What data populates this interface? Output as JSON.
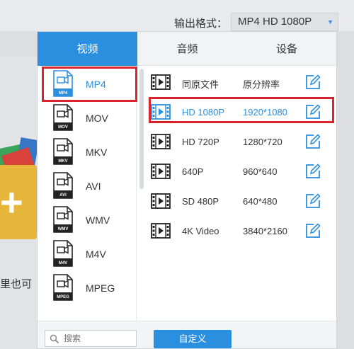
{
  "background": {
    "partial_text": "里也可"
  },
  "output_format": {
    "label": "输出格式：",
    "value": "MP4  HD 1080P"
  },
  "tabs": [
    {
      "label": "视频",
      "active": true
    },
    {
      "label": "音频",
      "active": false
    },
    {
      "label": "设备",
      "active": false
    }
  ],
  "formats": [
    {
      "name": "MP4",
      "badge": "MP4",
      "selected": true
    },
    {
      "name": "MOV",
      "badge": "MOV",
      "selected": false
    },
    {
      "name": "MKV",
      "badge": "MKV",
      "selected": false
    },
    {
      "name": "AVI",
      "badge": "AVI",
      "selected": false
    },
    {
      "name": "WMV",
      "badge": "WMV",
      "selected": false
    },
    {
      "name": "M4V",
      "badge": "M4V",
      "selected": false
    },
    {
      "name": "MPEG",
      "badge": "MPEG",
      "selected": false
    }
  ],
  "resolutions": [
    {
      "name": "同原文件",
      "res": "原分辨率",
      "selected": false
    },
    {
      "name": "HD 1080P",
      "res": "1920*1080",
      "selected": true
    },
    {
      "name": "HD 720P",
      "res": "1280*720",
      "selected": false
    },
    {
      "name": "640P",
      "res": "960*640",
      "selected": false
    },
    {
      "name": "SD 480P",
      "res": "640*480",
      "selected": false
    },
    {
      "name": "4K Video",
      "res": "3840*2160",
      "selected": false
    }
  ],
  "search": {
    "placeholder": "搜索",
    "value": ""
  },
  "custom_button": "自定义",
  "colors": {
    "accent": "#2b8fdf",
    "highlight_box": "#d9232f"
  }
}
